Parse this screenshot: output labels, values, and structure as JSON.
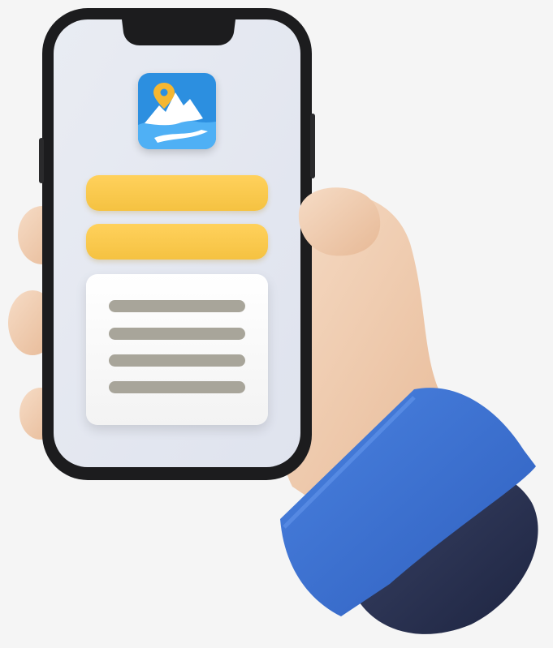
{
  "scene": {
    "description_icon": "map-pin-mountain-app-icon",
    "colors": {
      "background": "#f5f5f5",
      "phone_frame": "#1c1c1e",
      "screen": "#e6e9f0",
      "accent_yellow": "#f7c845",
      "sleeve_blue": "#3b6fd0",
      "sleeve_dark": "#2a3350",
      "skin": "#f2d2b8",
      "placeholder_line": "#a8a59a",
      "icon_blue": "#2c8fe0"
    },
    "icons": {
      "app": "mountain-map-icon",
      "pin": "location-pin-icon"
    }
  }
}
